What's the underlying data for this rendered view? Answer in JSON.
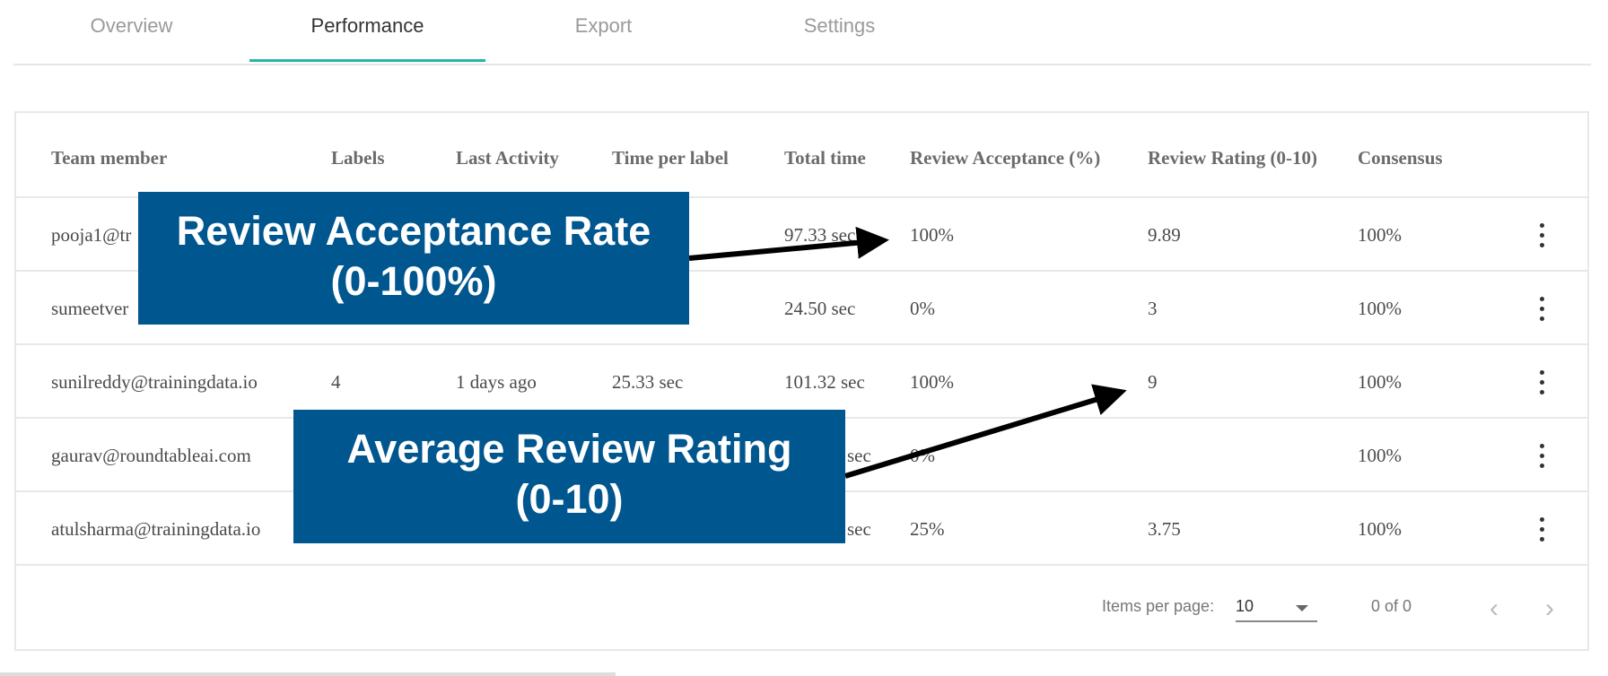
{
  "tabs": [
    {
      "label": "Overview"
    },
    {
      "label": "Performance",
      "active": true
    },
    {
      "label": "Export"
    },
    {
      "label": "Settings"
    }
  ],
  "accent_color": "#26b5a8",
  "table": {
    "headers": [
      "Team member",
      "Labels",
      "Last Activity",
      "Time per label",
      "Total time",
      "Review Acceptance (%)",
      "Review Rating (0-10)",
      "Consensus"
    ],
    "rows": [
      {
        "member": "pooja1@tr",
        "labels": "",
        "last": "",
        "tpl": "",
        "total": "97.33 sec",
        "acc": "100%",
        "rating": "9.89",
        "consensus": "100%"
      },
      {
        "member": "sumeetver",
        "labels": "",
        "last": "",
        "tpl": "",
        "total": "24.50 sec",
        "acc": "0%",
        "rating": "3",
        "consensus": "100%"
      },
      {
        "member": "sunilreddy@trainingdata.io",
        "labels": "4",
        "last": "1 days ago",
        "tpl": "25.33 sec",
        "total": "101.32 sec",
        "acc": "100%",
        "rating": "9",
        "consensus": "100%"
      },
      {
        "member": "gaurav@roundtableai.com",
        "labels": "",
        "last": "",
        "tpl": "",
        "total": "sec",
        "acc": "0%",
        "rating": "",
        "consensus": "100%"
      },
      {
        "member": "atulsharma@trainingdata.io",
        "labels": "",
        "last": "",
        "tpl": "",
        "total": "sec",
        "acc": "25%",
        "rating": "3.75",
        "consensus": "100%"
      }
    ],
    "row_menu_icon": "more-vert-icon"
  },
  "pagination": {
    "items_per_page_label": "Items per page:",
    "items_per_page": "10",
    "range": "0 of 0",
    "prev_icon": "chevron-left-icon",
    "next_icon": "chevron-right-icon"
  },
  "annotations": [
    {
      "line1": "Review Acceptance Rate",
      "line2": "(0-100%)",
      "color": "#00568f"
    },
    {
      "line1": "Average Review Rating",
      "line2": "(0-10)",
      "color": "#00568f"
    }
  ]
}
